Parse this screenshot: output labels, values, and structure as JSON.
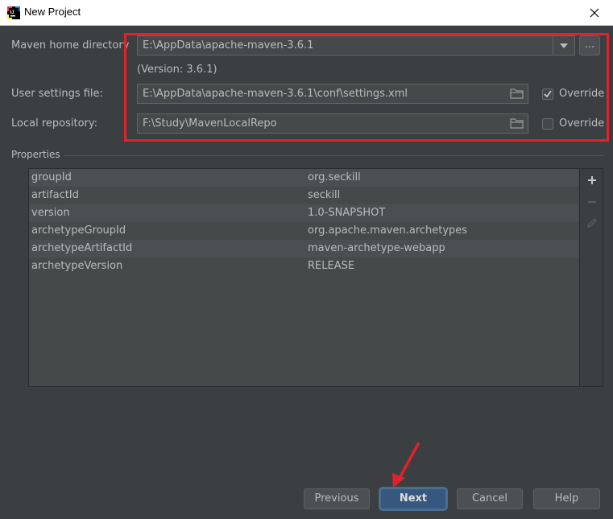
{
  "window": {
    "title": "New Project"
  },
  "maven": {
    "home_label": "Maven home directory",
    "home_value": "E:\\AppData\\apache-maven-3.6.1",
    "version_text": "(Version: 3.6.1)",
    "browse_label": "...",
    "settings_label": "User settings file:",
    "settings_value": "E:\\AppData\\apache-maven-3.6.1\\conf\\settings.xml",
    "settings_override_label": "Override",
    "settings_override_checked": true,
    "repo_label": "Local repository:",
    "repo_value": "F:\\Study\\MavenLocalRepo",
    "repo_override_label": "Override",
    "repo_override_checked": false
  },
  "properties": {
    "section_title": "Properties",
    "rows": [
      {
        "key": "groupId",
        "value": "org.seckill"
      },
      {
        "key": "artifactId",
        "value": "seckill"
      },
      {
        "key": "version",
        "value": "1.0-SNAPSHOT"
      },
      {
        "key": "archetypeGroupId",
        "value": "org.apache.maven.archetypes"
      },
      {
        "key": "archetypeArtifactId",
        "value": "maven-archetype-webapp"
      },
      {
        "key": "archetypeVersion",
        "value": "RELEASE"
      }
    ]
  },
  "buttons": {
    "previous": "Previous",
    "next": "Next",
    "cancel": "Cancel",
    "help": "Help"
  },
  "colors": {
    "background": "#3c3f41",
    "highlight_box": "#e0222a",
    "default_button": "#365880"
  },
  "icons": [
    "app-icon",
    "close-icon",
    "chevron-down-icon",
    "folder-icon",
    "checkmark-icon",
    "plus-icon",
    "minus-icon",
    "pencil-icon",
    "arrow-annotation"
  ]
}
